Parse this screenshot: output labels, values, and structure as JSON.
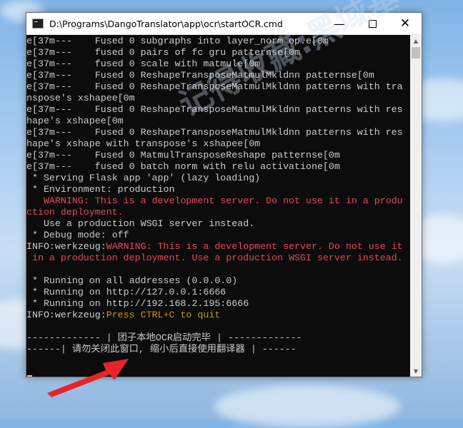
{
  "window": {
    "title": "D:\\Programs\\DangoTranslator\\app\\ocr\\startOCR.cmd",
    "minimize_glyph": "—",
    "close_glyph": "✕"
  },
  "watermark_text": "记得收藏:黑域基地 hybase.com",
  "console_lines": [
    [
      {
        "t": "e[37m---    Fused 0 subgraphs into layer_norm op.e[0m",
        "c": "n"
      }
    ],
    [
      {
        "t": "e[37m---    fused 0 pairs of fc gru patternse[0m",
        "c": "n"
      }
    ],
    [
      {
        "t": "e[37m---    fused 0 scale with matmule[0m",
        "c": "n"
      }
    ],
    [
      {
        "t": "e[37m---    Fused 0 ReshapeTransposeMatmulMkldnn patternse[0m",
        "c": "n"
      }
    ],
    [
      {
        "t": "e[37m---    Fused 0 ReshapeTransposeMatmulMkldnn patterns with tra",
        "c": "n"
      }
    ],
    [
      {
        "t": "nspose's xshapee[0m",
        "c": "n"
      }
    ],
    [
      {
        "t": "e[37m---    Fused 0 ReshapeTransposeMatmulMkldnn patterns with res",
        "c": "n"
      }
    ],
    [
      {
        "t": "hape's xshapee[0m",
        "c": "n"
      }
    ],
    [
      {
        "t": "e[37m---    Fused 0 ReshapeTransposeMatmulMkldnn patterns with res",
        "c": "n"
      }
    ],
    [
      {
        "t": "hape's xshape with transpose's xshapee[0m",
        "c": "n"
      }
    ],
    [
      {
        "t": "e[37m---    Fused 0 MatmulTransposeReshape patternse[0m",
        "c": "n"
      }
    ],
    [
      {
        "t": "e[37m---    fused 0 batch norm with relu activatione[0m",
        "c": "n"
      }
    ],
    [
      {
        "t": " * Serving Flask app 'app' (lazy loading)",
        "c": "n"
      }
    ],
    [
      {
        "t": " * Environment: production",
        "c": "n"
      }
    ],
    [
      {
        "t": "   WARNING: This is a development server. Do not use it in a produ",
        "c": "r"
      }
    ],
    [
      {
        "t": "ction deployment.",
        "c": "r"
      }
    ],
    [
      {
        "t": "   Use a production WSGI server instead.",
        "c": "n"
      }
    ],
    [
      {
        "t": " * Debug mode: off",
        "c": "n"
      }
    ],
    [
      {
        "t": "INFO:werkzeug:",
        "c": "n"
      },
      {
        "t": "WARNING: This is a development server. Do not use it",
        "c": "r"
      }
    ],
    [
      {
        "t": " in a production deployment. Use a production WSGI server instead.",
        "c": "r"
      }
    ],
    [
      {
        "t": "",
        "c": "n"
      }
    ],
    [
      {
        "t": " * Running on all addresses (0.0.0.0)",
        "c": "n"
      }
    ],
    [
      {
        "t": " * Running on http://127.0.0.1:6666",
        "c": "n"
      }
    ],
    [
      {
        "t": " * Running on http://192.168.2.195:6666",
        "c": "n"
      }
    ],
    [
      {
        "t": "INFO:werkzeug:",
        "c": "n"
      },
      {
        "t": "Press CTRL+C to quit",
        "c": "y"
      }
    ],
    [
      {
        "t": "",
        "c": "n"
      }
    ],
    [
      {
        "t": "------------- | 团子本地OCR启动完毕 | -------------",
        "c": "n"
      }
    ],
    [
      {
        "t": "------| 请勿关闭此窗口, 缩小后直接使用翻译器 | ------",
        "c": "n"
      }
    ]
  ],
  "colors": {
    "console_bg": "#0c0c0c",
    "console_text": "#cccccc",
    "warning_red": "#e74856",
    "prompt_yellow": "#c19c00",
    "arrow_red": "#e8242a"
  }
}
